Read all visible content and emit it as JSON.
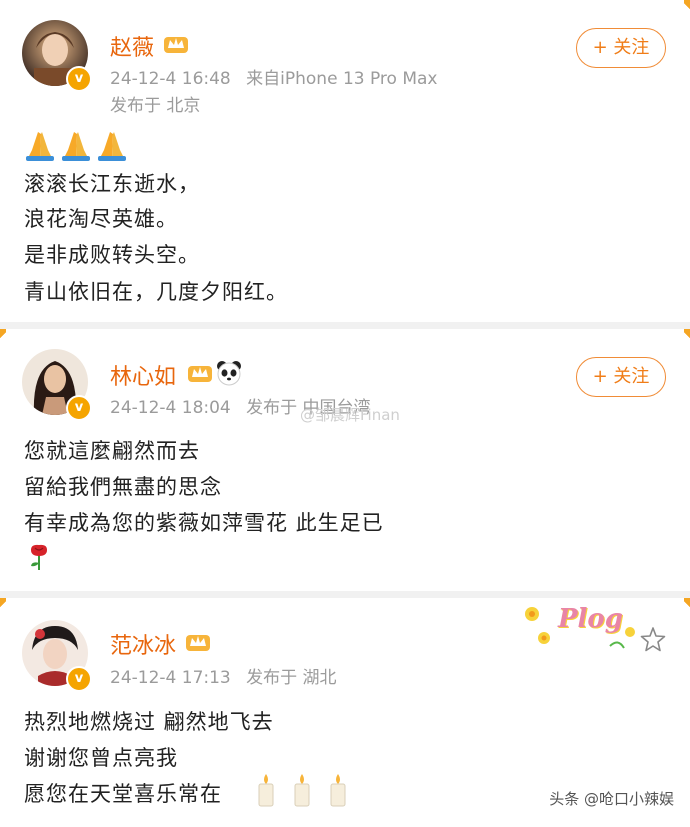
{
  "posts": [
    {
      "author": "赵薇",
      "time": "24-12-4 16:48",
      "source": "来自iPhone 13 Pro Max",
      "location": "发布于 北京",
      "follow_label": "+ 关注",
      "badge": "v",
      "lines": [
        "滚滚长江东逝水，",
        "浪花淘尽英雄。",
        "是非成败转头空。",
        "青山依旧在，几度夕阳红。"
      ],
      "emoji_icons": [
        "praying-hands-icon",
        "praying-hands-icon",
        "praying-hands-icon"
      ]
    },
    {
      "author": "林心如",
      "time": "24-12-4 18:04",
      "location": "发布于 中国台湾",
      "follow_label": "+ 关注",
      "badge": "v",
      "lines": [
        "您就這麼翩然而去",
        "留給我們無盡的思念",
        "有幸成為您的紫薇如萍雪花  此生足已"
      ],
      "emoji_icons": [
        "rose-icon"
      ]
    },
    {
      "author": "范冰冰",
      "time": "24-12-4 17:13",
      "location": "发布于 湖北",
      "badge": "v",
      "sticker_text": "Plog",
      "lines": [
        "热烈地燃烧过  翩然地飞去",
        "谢谢您曾点亮我",
        "愿您在天堂喜乐常在"
      ],
      "emoji_icons": [
        "candle-icon",
        "candle-icon",
        "candle-icon"
      ]
    }
  ],
  "watermark": "@邹晨辉Finan",
  "footer_watermark": "头条 @呛口小辣娱",
  "colors": {
    "name": "#e8660d",
    "follow": "#f07d18",
    "meta": "#9b9b9b",
    "accent": "#f5a623"
  }
}
